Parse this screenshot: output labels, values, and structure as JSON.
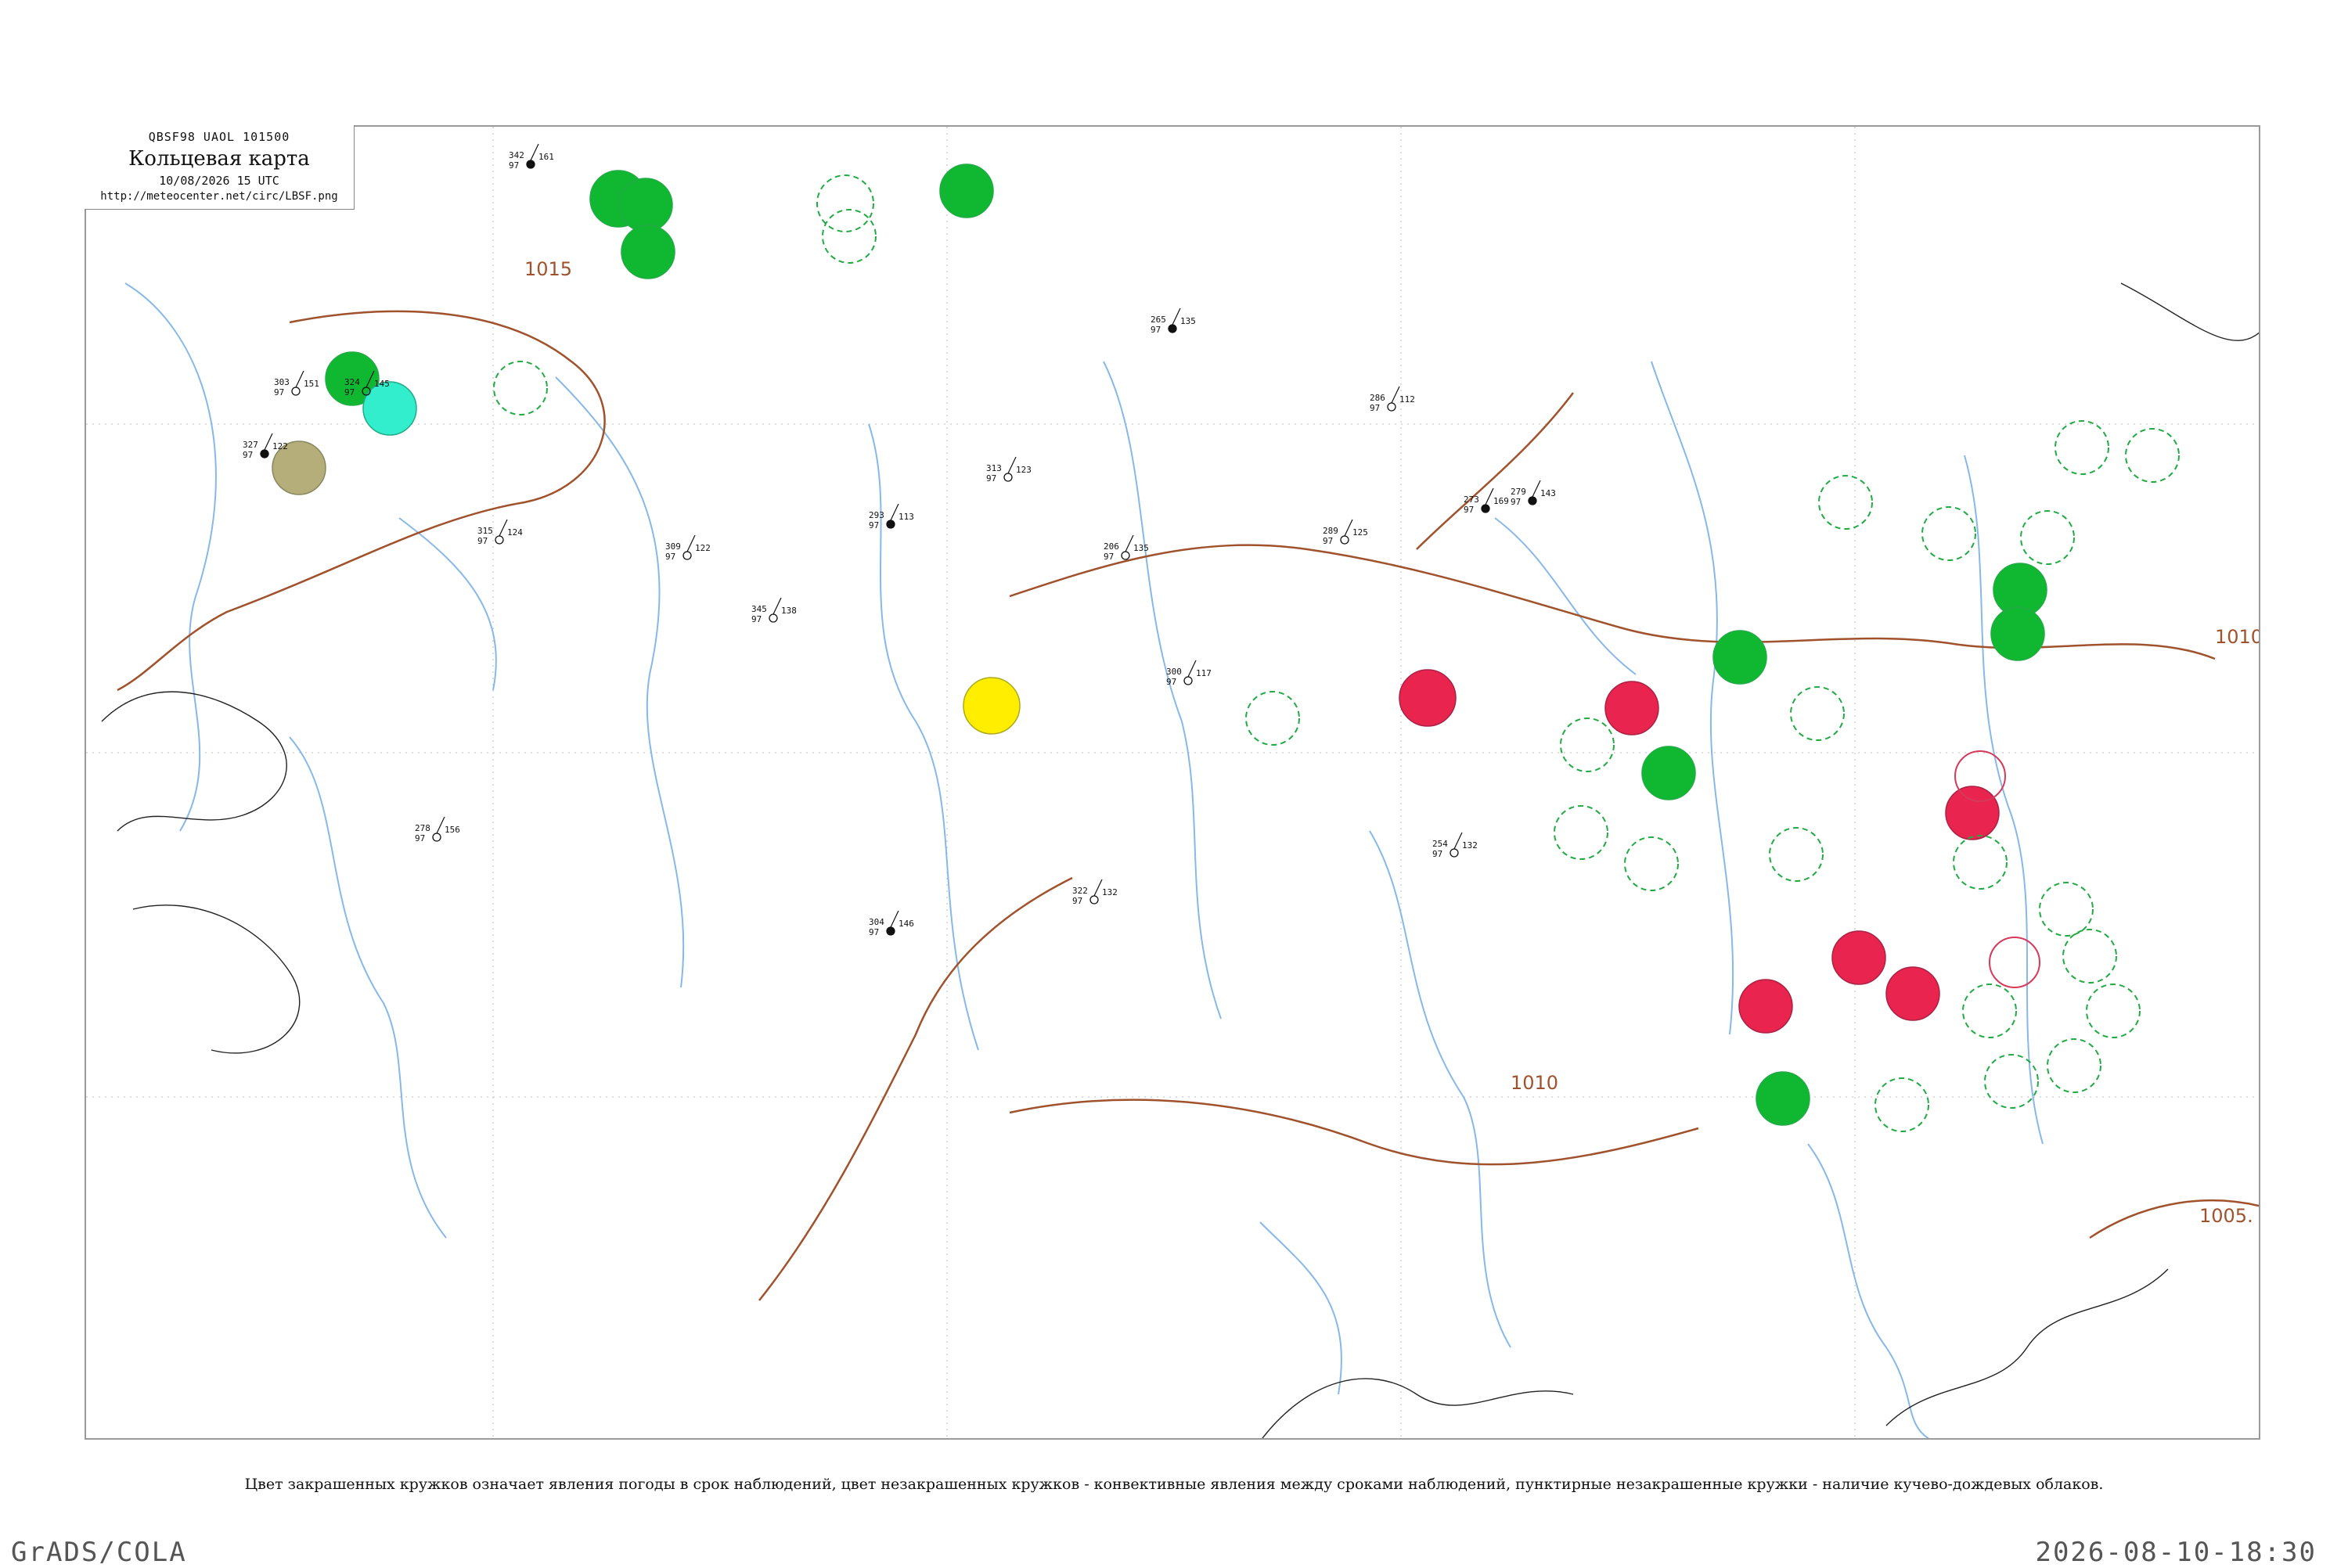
{
  "header": {
    "code": "QBSF98  UAOL  101500",
    "title": "Кольцевая карта",
    "time": "10/08/2026 15 UTC",
    "url": "http://meteocenter.net/circ/LBSF.png"
  },
  "caption": "Цвет закрашенных кружков означает явления погоды в срок наблюдений, цвет незакрашенных кружков - конвективные явления между сроками наблюдений, пунктирные незакрашенные кружки - наличие кучево-дождевых облаков.",
  "footer": {
    "left": "GrADS/COLA",
    "right": "2026-08-10-18:30"
  },
  "colors": {
    "green": "#0fb830",
    "red": "#e8244f",
    "yellow": "#ffee00",
    "cyan": "#33eecc",
    "olive": "#b5ad7a",
    "isobar": "#a0522d",
    "river": "#88b8e8",
    "dashed_green": "#22aa44"
  },
  "isobars": [
    {
      "value": "1015",
      "label": "1015"
    },
    {
      "value": "1010",
      "label": "1010"
    },
    {
      "value": "1005",
      "label": "1005."
    },
    {
      "value": "1010b",
      "label": "1010"
    }
  ],
  "stations": [
    {
      "temp": "342",
      "dew": "97",
      "press": "161"
    },
    {
      "temp": "324",
      "dew": "97",
      "press": "145"
    },
    {
      "temp": "303",
      "dew": "97",
      "press": "151"
    },
    {
      "temp": "327",
      "dew": "97",
      "press": "122"
    },
    {
      "temp": "315",
      "dew": "97",
      "press": "124"
    },
    {
      "temp": "309",
      "dew": "97",
      "press": "122"
    },
    {
      "temp": "293",
      "dew": "97",
      "press": "113"
    },
    {
      "temp": "206",
      "dew": "97",
      "press": "135"
    },
    {
      "temp": "289",
      "dew": "97",
      "press": "125"
    },
    {
      "temp": "279",
      "dew": "97",
      "press": "143"
    },
    {
      "temp": "345",
      "dew": "97",
      "press": "138"
    },
    {
      "temp": "313",
      "dew": "97",
      "press": "123"
    },
    {
      "temp": "265",
      "dew": "97",
      "press": "135"
    },
    {
      "temp": "286",
      "dew": "97",
      "press": "112"
    },
    {
      "temp": "300",
      "dew": "97",
      "press": "117"
    },
    {
      "temp": "273",
      "dew": "97",
      "press": "169"
    },
    {
      "temp": "254",
      "dew": "97",
      "press": "132"
    },
    {
      "temp": "322",
      "dew": "97",
      "press": "132"
    },
    {
      "temp": "304",
      "dew": "97",
      "press": "146"
    },
    {
      "temp": "278",
      "dew": "97",
      "press": "156"
    }
  ]
}
